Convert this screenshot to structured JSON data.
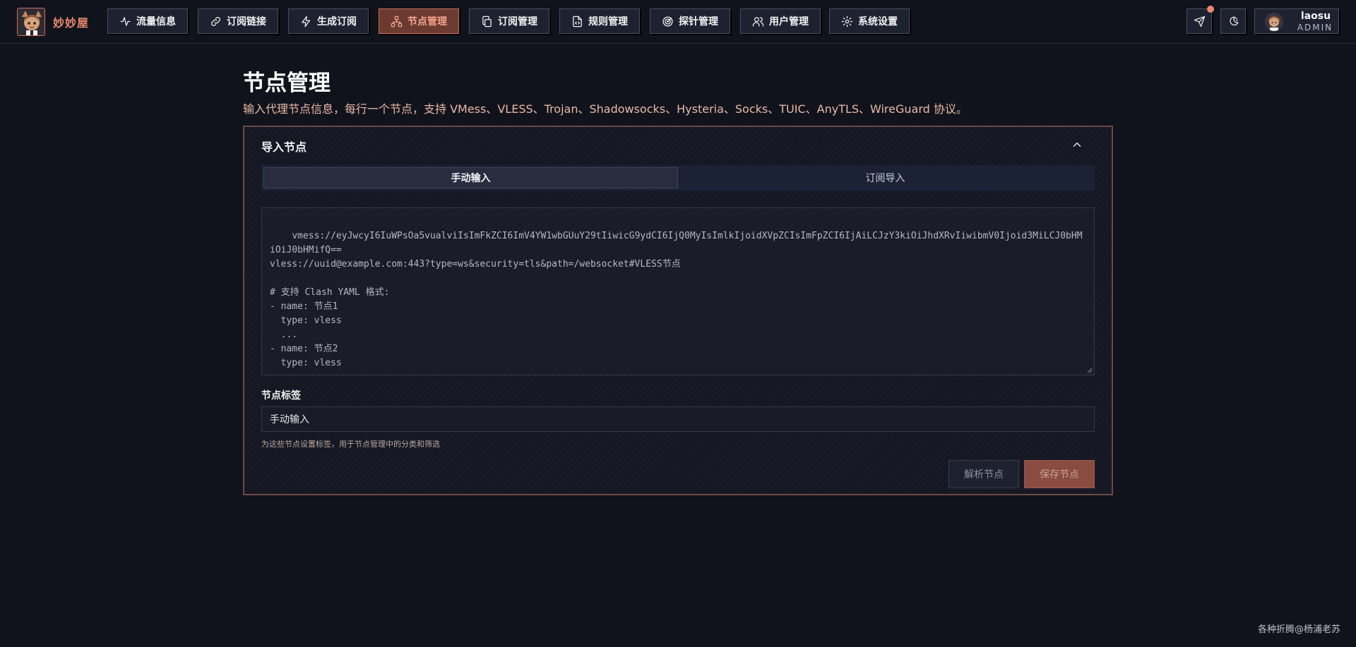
{
  "app": {
    "brand": "妙妙屋",
    "accent_color": "#e98a6f",
    "background_color": "#11131c"
  },
  "nav": {
    "items": [
      {
        "label": "流量信息",
        "icon": "activity-icon"
      },
      {
        "label": "订阅链接",
        "icon": "link-icon"
      },
      {
        "label": "生成订阅",
        "icon": "zap-icon"
      },
      {
        "label": "节点管理",
        "icon": "network-icon",
        "active": true
      },
      {
        "label": "订阅管理",
        "icon": "copy-icon"
      },
      {
        "label": "规则管理",
        "icon": "file-code-icon"
      },
      {
        "label": "探针管理",
        "icon": "radar-icon"
      },
      {
        "label": "用户管理",
        "icon": "users-icon"
      },
      {
        "label": "系统设置",
        "icon": "gear-icon"
      }
    ],
    "actions": [
      {
        "icon": "send-icon",
        "has_notification": true
      },
      {
        "icon": "theme-toggle-icon"
      }
    ]
  },
  "user": {
    "name": "laosu",
    "role": "ADMIN"
  },
  "page": {
    "title": "节点管理",
    "subtitle": "输入代理节点信息，每行一个节点，支持 VMess、VLESS、Trojan、Shadowsocks、Hysteria、Socks、TUIC、AnyTLS、WireGuard 协议。"
  },
  "import_card": {
    "title": "导入节点",
    "tabs": [
      {
        "label": "手动输入",
        "active": true
      },
      {
        "label": "订阅导入",
        "active": false
      }
    ],
    "textarea_placeholder": "vmess://eyJwcyI6IuWPsOa5vualviIsImFkZCI6ImV4YW1wbGUuY29tIiwicG9ydCI6IjQ0MyIsImlkIjoidXVpZCIsImFpZCI6IjAiLCJzY3kiOiJhdXRvIiwibmV0Ijoid3MiLCJ0bHMiOiJ0bHMifQ==\nvless://uuid@example.com:443?type=ws&security=tls&path=/websocket#VLESS节点\n\n# 支持 Clash YAML 格式:\n- name: 节点1\n  type: vless\n  ...\n- name: 节点2\n  type: vless\n  ...",
    "tag_label": "节点标签",
    "tag_value": "手动输入",
    "tag_help": "为这些节点设置标签，用于节点管理中的分类和筛选",
    "parse_button": "解析节点",
    "save_button": "保存节点"
  },
  "watermark": "各种折腾@杨浦老苏"
}
